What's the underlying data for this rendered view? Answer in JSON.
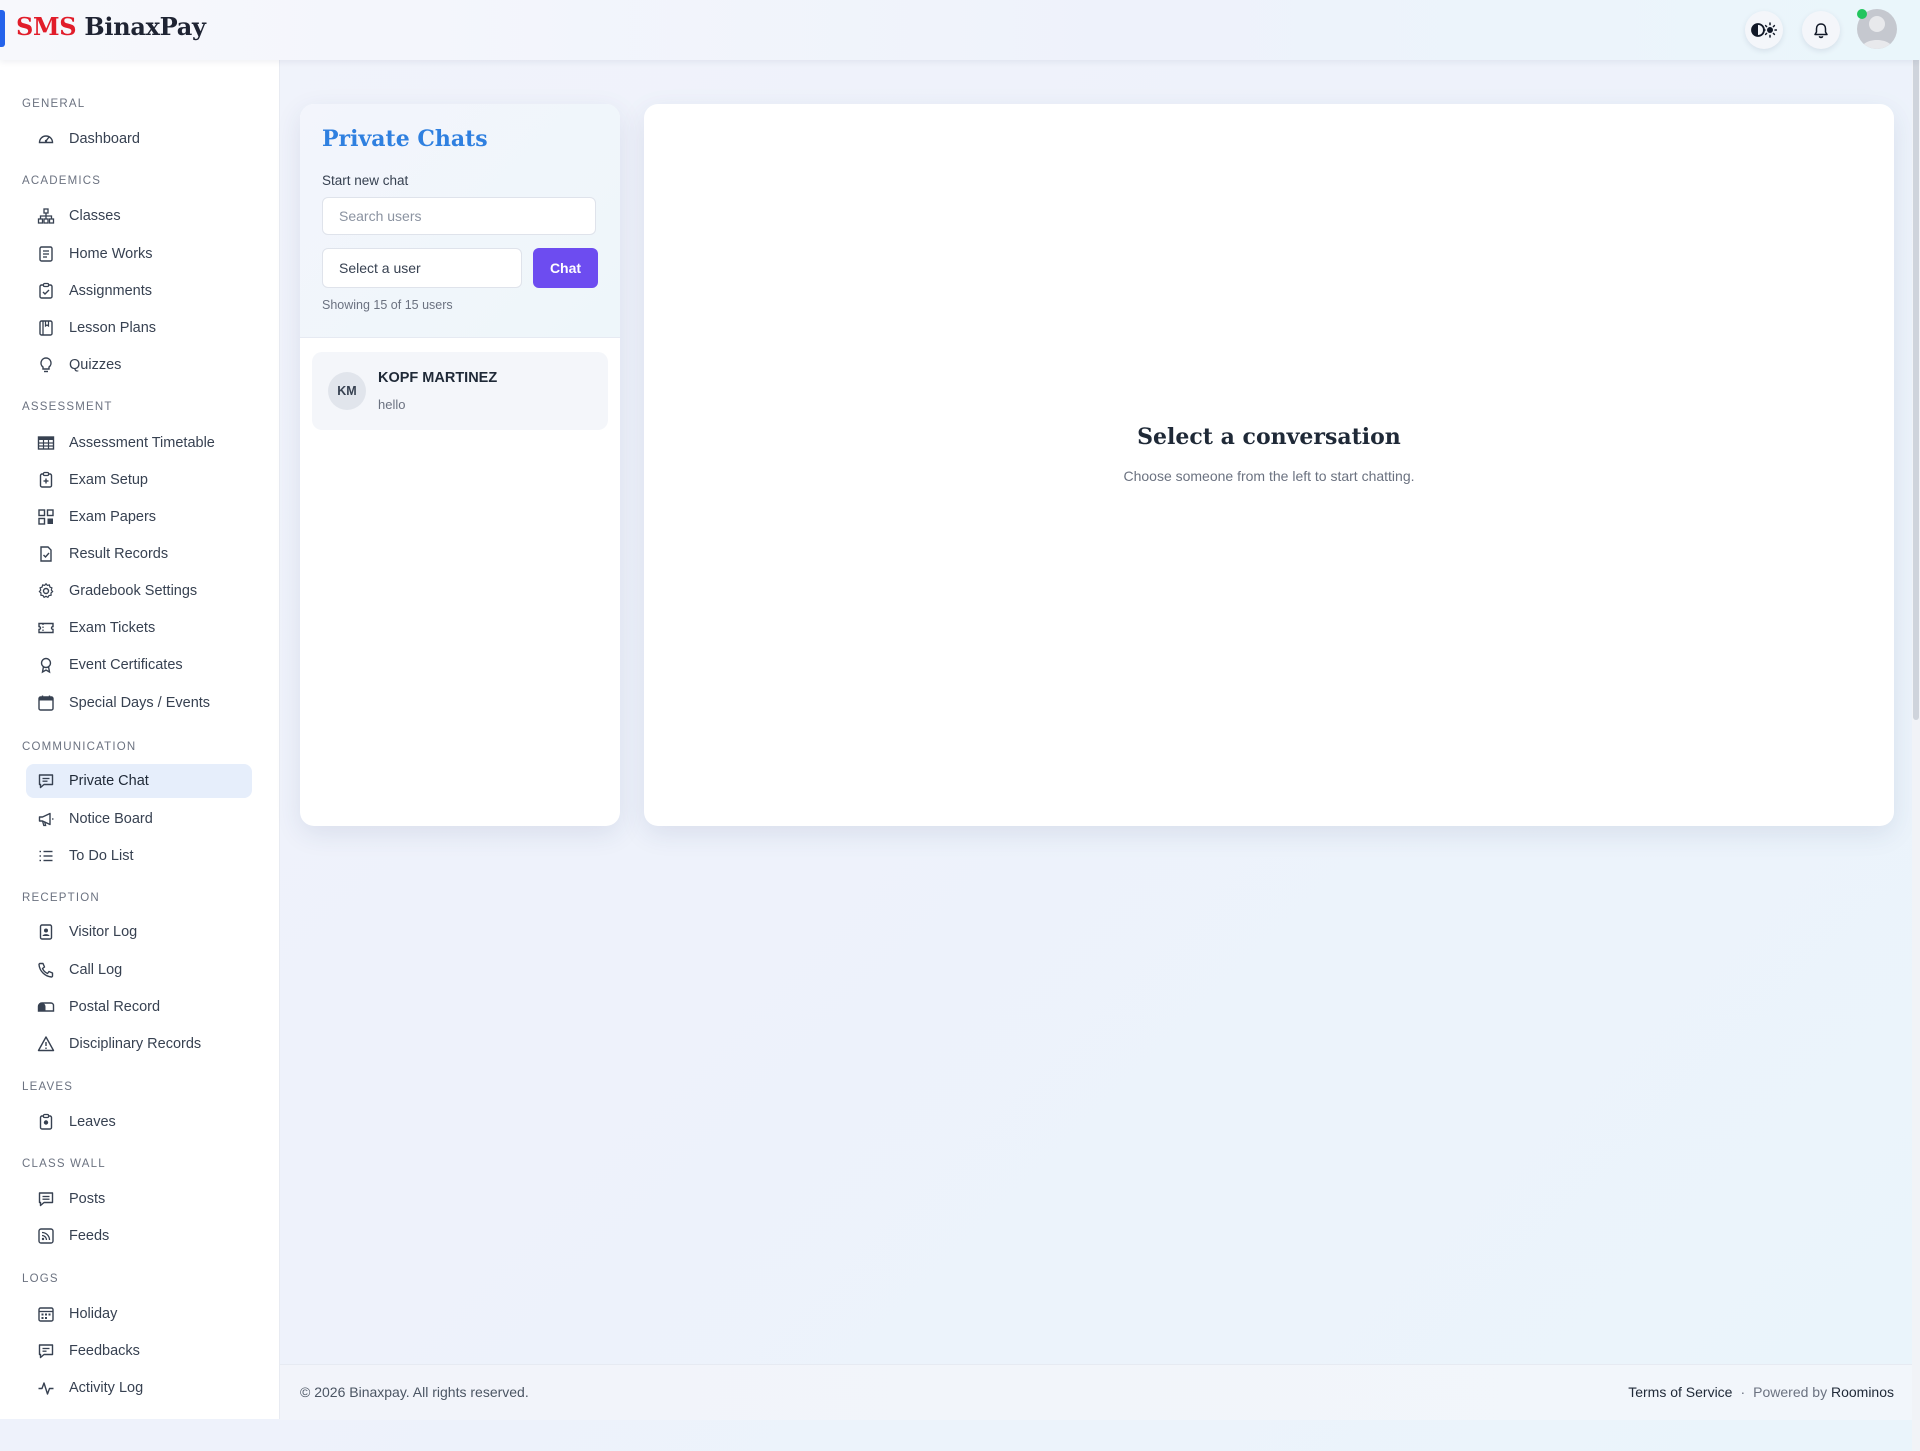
{
  "header": {
    "brand_sms": "SMS",
    "brand_name": "BinaxPay",
    "icons": [
      "theme-toggle-icon",
      "bell-icon",
      "avatar"
    ],
    "accent": "#2563eb",
    "brand_red": "#e11d2a",
    "online_status_color": "#22c55e"
  },
  "sidebar": {
    "sections": [
      {
        "title": "GENERAL",
        "items": [
          {
            "label": "Dashboard",
            "icon": "gauge-icon"
          }
        ]
      },
      {
        "title": "ACADEMICS",
        "items": [
          {
            "label": "Classes",
            "icon": "hierarchy-icon"
          },
          {
            "label": "Home Works",
            "icon": "document-icon"
          },
          {
            "label": "Assignments",
            "icon": "clipboard-check-icon"
          },
          {
            "label": "Lesson Plans",
            "icon": "book-icon"
          },
          {
            "label": "Quizzes",
            "icon": "lightbulb-icon"
          }
        ]
      },
      {
        "title": "ASSESSMENT",
        "items": [
          {
            "label": "Assessment Timetable",
            "icon": "table-icon"
          },
          {
            "label": "Exam Setup",
            "icon": "clipboard-plus-icon"
          },
          {
            "label": "Exam Papers",
            "icon": "grid-icon"
          },
          {
            "label": "Result Records",
            "icon": "document-check-icon"
          },
          {
            "label": "Gradebook Settings",
            "icon": "gear-icon"
          },
          {
            "label": "Exam Tickets",
            "icon": "ticket-icon"
          },
          {
            "label": "Event Certificates",
            "icon": "award-icon"
          },
          {
            "label": "Special Days / Events",
            "icon": "calendar-icon"
          }
        ]
      },
      {
        "title": "COMMUNICATION",
        "items": [
          {
            "label": "Private Chat",
            "icon": "chat-icon",
            "active": true
          },
          {
            "label": "Notice Board",
            "icon": "megaphone-icon"
          },
          {
            "label": "To Do List",
            "icon": "list-icon"
          }
        ]
      },
      {
        "title": "RECEPTION",
        "items": [
          {
            "label": "Visitor Log",
            "icon": "id-badge-icon"
          },
          {
            "label": "Call Log",
            "icon": "phone-icon"
          },
          {
            "label": "Postal Record",
            "icon": "mailbox-icon"
          },
          {
            "label": "Disciplinary Records",
            "icon": "warning-icon"
          }
        ]
      },
      {
        "title": "LEAVES",
        "items": [
          {
            "label": "Leaves",
            "icon": "clipboard-icon"
          }
        ]
      },
      {
        "title": "CLASS WALL",
        "items": [
          {
            "label": "Posts",
            "icon": "comment-icon"
          },
          {
            "label": "Feeds",
            "icon": "rss-icon"
          }
        ]
      },
      {
        "title": "LOGS",
        "items": [
          {
            "label": "Holiday",
            "icon": "calendar-list-icon"
          },
          {
            "label": "Feedbacks",
            "icon": "feedback-icon"
          },
          {
            "label": "Activity Log",
            "icon": "activity-icon"
          }
        ]
      }
    ]
  },
  "chat_list": {
    "title": "Private Chats",
    "start_label": "Start new chat",
    "search_placeholder": "Search users",
    "select_value": "Select a user",
    "chat_button": "Chat",
    "showing": "Showing 15 of 15 users",
    "title_color": "#2f80e0",
    "button_color": "#6d4cf0",
    "conversations": [
      {
        "initials": "KM",
        "name": "KOPF MARTINEZ",
        "last_message": "hello"
      }
    ]
  },
  "main": {
    "title": "Select a conversation",
    "subtitle": "Choose someone from the left to start chatting."
  },
  "footer": {
    "copyright": "© 2026 Binaxpay. All rights reserved.",
    "terms": "Terms of Service",
    "separator": "·",
    "powered_by": "Powered by",
    "powered_name": "Roominos"
  }
}
